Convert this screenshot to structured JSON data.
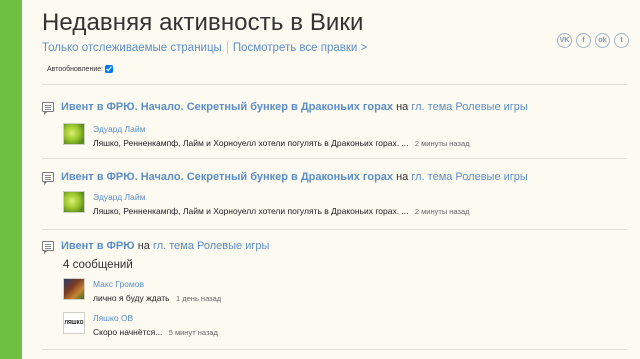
{
  "page": {
    "title": "Недавняя активность в Вики",
    "nav": [
      {
        "label": "Только отслеживаемые страницы"
      },
      {
        "label": "Посмотреть все правки >"
      }
    ],
    "social": [
      "vk-icon",
      "facebook-icon",
      "odnoklassniki-icon",
      "twitter-icon"
    ],
    "social_glyphs": [
      "VK",
      "f",
      "ok",
      "t"
    ],
    "autoupdate_label": "Автообновление:"
  },
  "entries": [
    {
      "thread": "Ивент в ФРЮ. Начало. Секретный бункер в Драконьих горах",
      "on": "на",
      "board": "гл. тема Ролевые игры",
      "count": "",
      "posts": [
        {
          "author": "Эдуард Лайм",
          "text": "Ляшко, Ренненкампф, Лайм и Хорноуелл хотели погулять в Драконьих горах. ...",
          "time": "2 минуты назад",
          "avatar": "lime"
        }
      ]
    },
    {
      "thread": "Ивент в ФРЮ. Начало. Секретный бункер в Драконьих горах",
      "on": "на",
      "board": "гл. тема Ролевые игры",
      "count": "",
      "posts": [
        {
          "author": "Эдуард Лайм",
          "text": "Ляшко, Ренненкампф, Лайм и Хорноуелл хотели погулять в Драконьих горах. ...",
          "time": "2 минуты назад",
          "avatar": "lime"
        }
      ]
    },
    {
      "thread": "Ивент в ФРЮ",
      "on": "на",
      "board": "гл. тема Ролевые игры",
      "count": "4 сообщений",
      "posts": [
        {
          "author": "Макс Громов",
          "text": "лично я буду ждать",
          "time": "1 день назад",
          "avatar": "game"
        },
        {
          "author": "Ляшко ОВ",
          "text": "Скоро начнётся...",
          "time": "5 минут назад",
          "avatar": "ЛЯШКО"
        }
      ]
    }
  ],
  "colors": {
    "accent_green": "#6ec043",
    "link": "#5b8fc8",
    "background": "#fdfaf2"
  }
}
